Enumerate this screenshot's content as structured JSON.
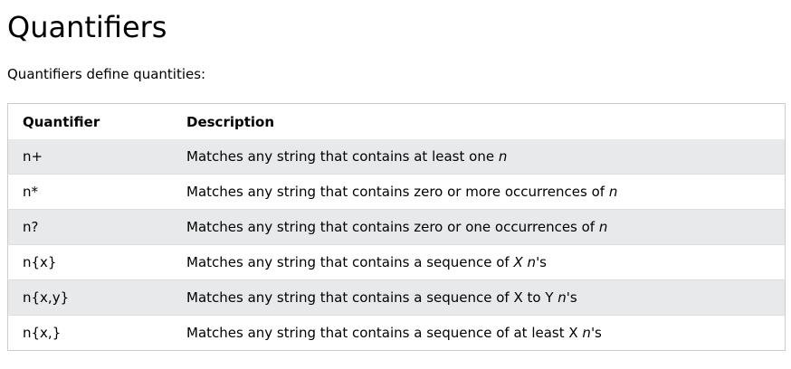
{
  "page": {
    "title": "Quantifiers",
    "intro": "Quantifiers define quantities:"
  },
  "table": {
    "headers": [
      "Quantifier",
      "Description"
    ],
    "rows": [
      {
        "quantifier": "n+",
        "desc_prefix": "Matches any string that contains at least one ",
        "desc_var": "n",
        "desc_suffix": ""
      },
      {
        "quantifier": "n*",
        "desc_prefix": "Matches any string that contains zero or more occurrences of ",
        "desc_var": "n",
        "desc_suffix": ""
      },
      {
        "quantifier": "n?",
        "desc_prefix": "Matches any string that contains zero or one occurrences of ",
        "desc_var": "n",
        "desc_suffix": ""
      },
      {
        "quantifier": "n{x}",
        "desc_prefix": "Matches any string that contains a sequence of ",
        "desc_var_pre": "X",
        "desc_mid": " ",
        "desc_var": "n",
        "desc_suffix": "'s"
      },
      {
        "quantifier": "n{x,y}",
        "desc_prefix": "Matches any string that contains a sequence of X to Y ",
        "desc_var": "n",
        "desc_suffix": "'s"
      },
      {
        "quantifier": "n{x,}",
        "desc_prefix": "Matches any string that contains a sequence of at least X ",
        "desc_var": "n",
        "desc_suffix": "'s"
      }
    ]
  }
}
